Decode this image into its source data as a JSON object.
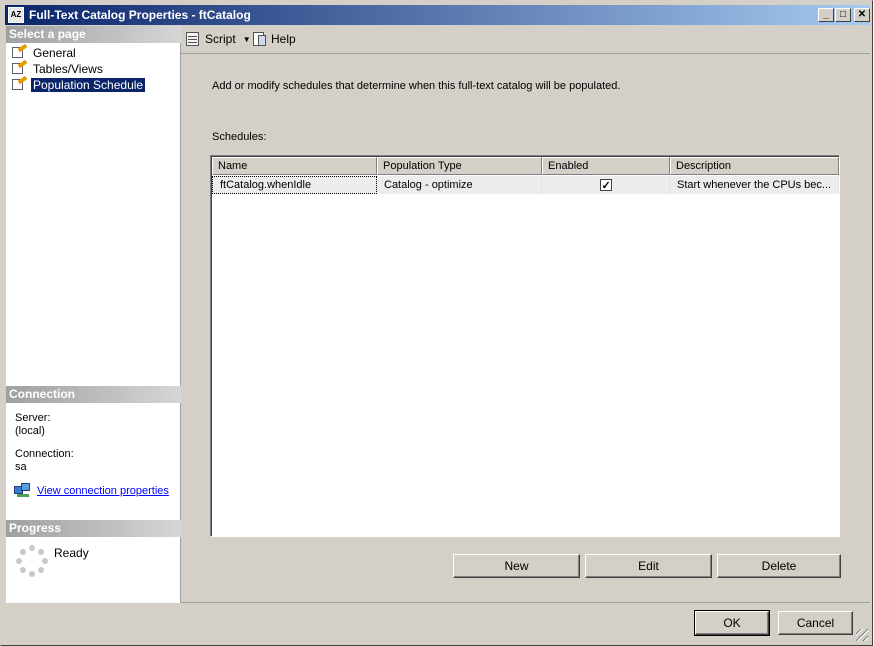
{
  "window": {
    "title": "Full-Text Catalog Properties - ftCatalog"
  },
  "title_buttons": {
    "minimize": "_",
    "maximize": "□",
    "close": "✕"
  },
  "sidebar": {
    "select_header": "Select a page",
    "pages": [
      {
        "label": "General"
      },
      {
        "label": "Tables/Views"
      },
      {
        "label": "Population Schedule"
      }
    ],
    "connection": {
      "header": "Connection",
      "server_label": "Server:",
      "server_value": "(local)",
      "connection_label": "Connection:",
      "connection_value": "sa",
      "link_text": "View connection properties"
    },
    "progress": {
      "header": "Progress",
      "status": "Ready"
    }
  },
  "toolbar": {
    "script_label": "Script",
    "help_label": "Help"
  },
  "main": {
    "description": "Add or modify schedules that determine when this full-text catalog will be populated.",
    "schedules_label": "Schedules:",
    "columns": [
      "Name",
      "Population Type",
      "Enabled",
      "Description"
    ],
    "rows": [
      {
        "name": "ftCatalog.whenIdle",
        "population_type": "Catalog - optimize",
        "enabled": true,
        "description": "Start whenever the CPUs bec..."
      }
    ],
    "buttons": {
      "new": "New",
      "edit": "Edit",
      "delete": "Delete"
    }
  },
  "footer": {
    "ok": "OK",
    "cancel": "Cancel"
  },
  "colors": {
    "title_start": "#0a246a",
    "title_end": "#a6caf0",
    "selected": "#0a246a",
    "face": "#d4d0c8",
    "link": "#0000ff"
  }
}
